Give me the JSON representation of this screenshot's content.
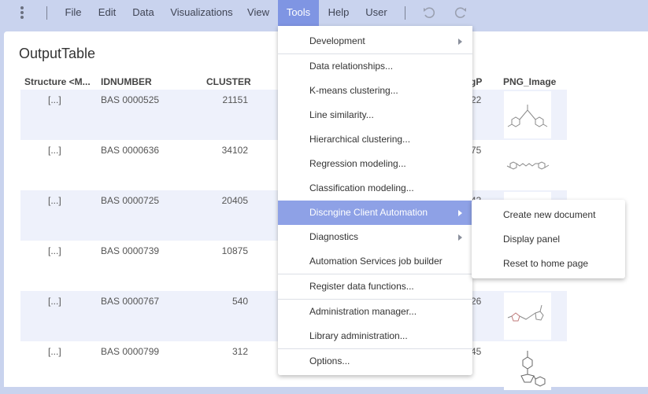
{
  "menubar": {
    "items": [
      "File",
      "Edit",
      "Data",
      "Visualizations",
      "View",
      "Tools",
      "Help",
      "User"
    ],
    "active": "Tools",
    "icons": {
      "menu": "kebab-menu-icon",
      "undo": "undo-icon",
      "redo": "redo-icon"
    }
  },
  "table": {
    "title": "OutputTable",
    "columns": [
      "Structure <M...",
      "IDNUMBER",
      "CLUSTER",
      "gP",
      "PNG_Image"
    ],
    "rows": [
      {
        "structure": "[...]",
        "id": "BAS 0000525",
        "cluster": "21151",
        "logp": "22"
      },
      {
        "structure": "[...]",
        "id": "BAS 0000636",
        "cluster": "34102",
        "logp": "75"
      },
      {
        "structure": "[...]",
        "id": "BAS 0000725",
        "cluster": "20405",
        "logp": "43"
      },
      {
        "structure": "[...]",
        "id": "BAS 0000739",
        "cluster": "10875",
        "logp": ""
      },
      {
        "structure": "[...]",
        "id": "BAS 0000767",
        "cluster": "540",
        "logp": "26"
      },
      {
        "structure": "[...]",
        "id": "BAS 0000799",
        "cluster": "312",
        "logp": "45"
      }
    ]
  },
  "tools_menu": {
    "items": [
      {
        "label": "Development",
        "submenu": true
      },
      {
        "label": "Data relationships...",
        "submenu": false
      },
      {
        "label": "K-means clustering...",
        "submenu": false
      },
      {
        "label": "Line similarity...",
        "submenu": false
      },
      {
        "label": "Hierarchical clustering...",
        "submenu": false
      },
      {
        "label": "Regression modeling...",
        "submenu": false
      },
      {
        "label": "Classification modeling...",
        "submenu": false
      },
      {
        "label": "Discngine Client Automation",
        "submenu": true,
        "highlighted": true
      },
      {
        "label": "Diagnostics",
        "submenu": true
      },
      {
        "label": "Automation Services job builder",
        "submenu": false
      },
      {
        "label": "Register data functions...",
        "submenu": false
      },
      {
        "label": "Administration manager...",
        "submenu": false
      },
      {
        "label": "Library administration...",
        "submenu": false
      },
      {
        "label": "Options...",
        "submenu": false
      }
    ]
  },
  "submenu": {
    "items": [
      "Create new document",
      "Display panel",
      "Reset to home page"
    ]
  },
  "colors": {
    "menubar_bg": "#c9d3ee",
    "active_menu": "#7f95e3",
    "highlight_item": "#8ea1e6",
    "row_shade": "#eef1fb"
  }
}
